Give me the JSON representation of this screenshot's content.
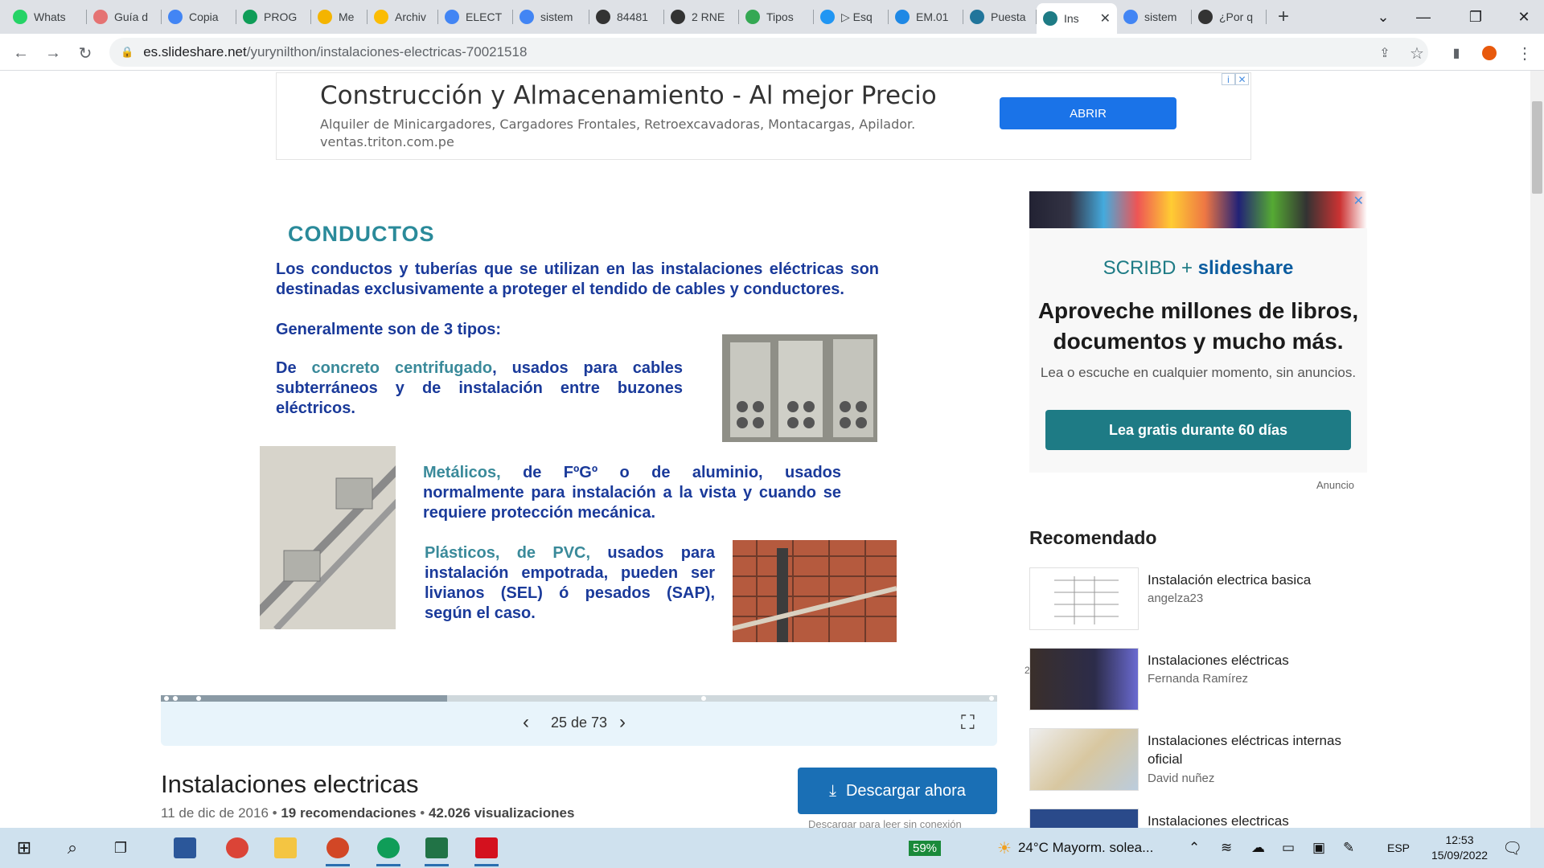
{
  "browser": {
    "tabs": [
      {
        "label": "Whats",
        "color": "#25d366"
      },
      {
        "label": "Guía d",
        "color": "#e57373"
      },
      {
        "label": "Copia",
        "color": "#4285f4"
      },
      {
        "label": "PROG",
        "color": "#0f9d58"
      },
      {
        "label": "Me",
        "color": "#f4b400"
      },
      {
        "label": "Archiv",
        "color": "#fbbc04"
      },
      {
        "label": "ELECT",
        "color": "#4285f4"
      },
      {
        "label": "sistem",
        "color": "#4285f4"
      },
      {
        "label": "84481",
        "color": "#333333"
      },
      {
        "label": "2 RNE",
        "color": "#333333"
      },
      {
        "label": "Tipos",
        "color": "#34a853"
      },
      {
        "label": "▷ Esq",
        "color": "#2196f3"
      },
      {
        "label": "EM.01",
        "color": "#1e88e5"
      },
      {
        "label": "Puesta",
        "color": "#21759b"
      },
      {
        "label": "Ins",
        "color": "#1e7b85"
      },
      {
        "label": "sistem",
        "color": "#4285f4"
      },
      {
        "label": "¿Por q",
        "color": "#333333"
      }
    ],
    "new_tab": "+",
    "url_host": "es.slideshare.net",
    "url_path": "/yurynilthon/instalaciones-electricas-70021518"
  },
  "top_ad": {
    "title": "Construcción y Almacenamiento - Al mejor Precio",
    "description": "Alquiler de Minicargadores, Cargadores Frontales, Retroexcavadoras, Montacargas, Apilador.",
    "url": "ventas.triton.com.pe",
    "button": "ABRIR"
  },
  "slide": {
    "heading": "CONDUCTOS",
    "intro": "Los conductos y tuberías que se utilizan en las instalaciones eléctricas son destinadas exclusivamente a proteger el tendido de cables y conductores.",
    "types": "Generalmente son de 3 tipos:",
    "concreto_prefix": "De ",
    "concreto_term": "concreto centrifugado",
    "concreto_rest": ", usados para cables subterráneos y de instalación entre buzones eléctricos.",
    "metal_term": "Metálicos,",
    "metal_rest": " de FºGº o de aluminio, usados normalmente para instalación a la vista y cuando se requiere protección mecánica.",
    "pvc_term": "Plásticos, de PVC,",
    "pvc_rest": " usados para instalación empotrada, pueden ser livianos (SEL) ó pesados (SAP), según el caso.",
    "page_number": "25"
  },
  "viewer": {
    "counter": "25 de 73",
    "progress_fraction": 0.342
  },
  "document": {
    "title": "Instalaciones electricas",
    "date": "11 de dic de 2016",
    "recommendations": "19 recomendaciones",
    "views": "42.026 visualizaciones",
    "download": "Descargar ahora",
    "download_sub": "Descargar para leer sin conexión"
  },
  "side_ad": {
    "brand1": "SCRIBD",
    "plus": "+",
    "brand2": "slideshare",
    "headline": "Aproveche millones de libros, documentos y mucho más.",
    "sub": "Lea o escuche en cualquier momento, sin anuncios.",
    "cta": "Lea gratis durante 60 días",
    "label": "Anuncio"
  },
  "recommended": {
    "heading": "Recomendado",
    "items": [
      {
        "title": "Instalación electrica basica",
        "author": "angelza23"
      },
      {
        "title": "Instalaciones eléctricas",
        "author": "Fernanda Ramírez"
      },
      {
        "title": "Instalaciones eléctricas internas oficial",
        "author": "David nuñez"
      },
      {
        "title": "Instalaciones electricas",
        "author": ""
      }
    ]
  },
  "taskbar": {
    "battery": "59%",
    "weather": "24°C  Mayorm. solea...",
    "lang": "ESP",
    "time": "12:53",
    "date": "15/09/2022"
  }
}
